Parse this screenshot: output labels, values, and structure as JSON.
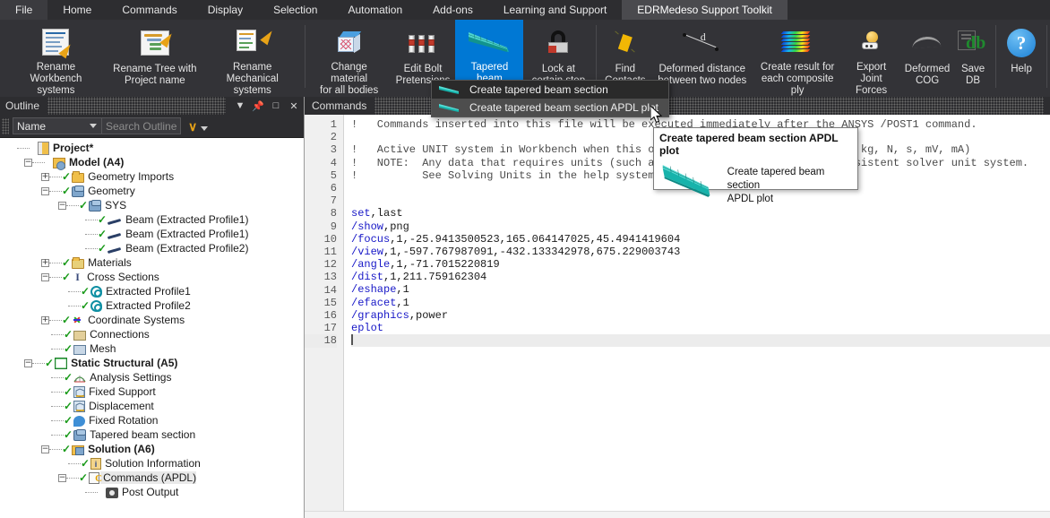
{
  "menu": {
    "items": [
      {
        "label": "File",
        "state": "file"
      },
      {
        "label": "Home",
        "state": "normal"
      },
      {
        "label": "Commands",
        "state": "normal"
      },
      {
        "label": "Display",
        "state": "normal"
      },
      {
        "label": "Selection",
        "state": "normal"
      },
      {
        "label": "Automation",
        "state": "normal"
      },
      {
        "label": "Add-ons",
        "state": "normal"
      },
      {
        "label": "Learning and Support",
        "state": "normal"
      },
      {
        "label": "EDRMedeso Support Toolkit",
        "state": "active"
      }
    ]
  },
  "ribbon": {
    "buttons": [
      {
        "label": "Rename Workbench\nsystems",
        "icon": "rename-workbench-icon"
      },
      {
        "label": "Rename Tree with\nProject name",
        "icon": "rename-tree-icon"
      },
      {
        "label": "Rename Mechanical\nsystems",
        "icon": "rename-mechanical-icon"
      },
      {
        "label": "Change material\nfor all bodies",
        "icon": "change-material-icon"
      },
      {
        "label": "Edit Bolt\nPretensions",
        "icon": "edit-bolt-pretensions-icon"
      },
      {
        "label": "Tapered beam\nsection",
        "icon": "tapered-beam-section-icon",
        "selected": true,
        "has_dropdown": true
      },
      {
        "label": "Lock at\ncertain step",
        "icon": "lock-at-certain-step-icon"
      },
      {
        "label": "Find\nContacts",
        "icon": "find-contacts-icon"
      },
      {
        "label": "Deformed distance\nbetween two nodes",
        "icon": "deformed-distance-icon"
      },
      {
        "label": "Create result for\neach composite ply",
        "icon": "composite-ply-icon"
      },
      {
        "label": "Export Joint\nForces",
        "icon": "export-joint-forces-icon"
      },
      {
        "label": "Deformed\nCOG",
        "icon": "deformed-cog-icon"
      },
      {
        "label": "Save\nDB",
        "icon": "save-db-icon",
        "icon_text": "db"
      },
      {
        "label": "Help",
        "icon": "help-icon",
        "icon_text": "?"
      }
    ]
  },
  "dropdown": {
    "items": [
      {
        "label": "Create tapered beam section",
        "hover": false
      },
      {
        "label": "Create tapered beam section APDL plot",
        "hover": true
      }
    ]
  },
  "tooltip": {
    "title": "Create tapered beam section APDL plot",
    "body": "Create tapered beam section\nAPDL plot"
  },
  "outline": {
    "title": "Outline",
    "title_buttons": [
      "chevron-down-icon",
      "pin-icon",
      "maximize-icon",
      "close-icon"
    ],
    "filter_selected": "Name",
    "search_placeholder": "Search Outline",
    "tree": [
      {
        "label": "Project*",
        "depth": 0,
        "expander": "",
        "check": "",
        "icon": "project-icon",
        "bold": true
      },
      {
        "label": "Model (A4)",
        "depth": 1,
        "expander": "-",
        "check": "",
        "icon": "model-icon",
        "bold": true
      },
      {
        "label": "Geometry Imports",
        "depth": 2,
        "expander": "+",
        "check": "ok",
        "icon": "folder-icon"
      },
      {
        "label": "Geometry",
        "depth": 2,
        "expander": "-",
        "check": "ok",
        "icon": "geometry-icon"
      },
      {
        "label": "SYS",
        "depth": 3,
        "expander": "-",
        "check": "okx",
        "icon": "geometry-icon"
      },
      {
        "label": "Beam (Extracted Profile1)",
        "depth": 4,
        "expander": "",
        "check": "okx",
        "icon": "beam-icon"
      },
      {
        "label": "Beam (Extracted Profile1)",
        "depth": 4,
        "expander": "",
        "check": "okx",
        "icon": "beam-icon"
      },
      {
        "label": "Beam (Extracted Profile2)",
        "depth": 4,
        "expander": "",
        "check": "okx",
        "icon": "beam-icon"
      },
      {
        "label": "Materials",
        "depth": 2,
        "expander": "+",
        "check": "ok",
        "icon": "materials-icon"
      },
      {
        "label": "Cross Sections",
        "depth": 2,
        "expander": "-",
        "check": "ok",
        "icon": "cross-section-icon"
      },
      {
        "label": "Extracted Profile1",
        "depth": 3,
        "expander": "",
        "check": "ok",
        "icon": "profile-icon"
      },
      {
        "label": "Extracted Profile2",
        "depth": 3,
        "expander": "",
        "check": "ok",
        "icon": "profile-icon"
      },
      {
        "label": "Coordinate Systems",
        "depth": 2,
        "expander": "+",
        "check": "okx",
        "icon": "coordinate-systems-icon"
      },
      {
        "label": "Connections",
        "depth": 2,
        "expander": "",
        "check": "ok",
        "icon": "connections-icon"
      },
      {
        "label": "Mesh",
        "depth": 2,
        "expander": "",
        "check": "ok",
        "icon": "mesh-icon"
      },
      {
        "label": "Static Structural (A5)",
        "depth": 1,
        "expander": "-",
        "check": "ok",
        "icon": "static-structural-icon",
        "bold": true
      },
      {
        "label": "Analysis Settings",
        "depth": 2,
        "expander": "",
        "check": "ok",
        "icon": "analysis-settings-icon"
      },
      {
        "label": "Fixed Support",
        "depth": 2,
        "expander": "",
        "check": "ok",
        "icon": "support-icon"
      },
      {
        "label": "Displacement",
        "depth": 2,
        "expander": "",
        "check": "ok",
        "icon": "support-icon"
      },
      {
        "label": "Fixed Rotation",
        "depth": 2,
        "expander": "",
        "check": "ok",
        "icon": "rotation-icon"
      },
      {
        "label": "Tapered beam section",
        "depth": 2,
        "expander": "",
        "check": "okx",
        "icon": "geometry-icon"
      },
      {
        "label": "Solution (A6)",
        "depth": 2,
        "expander": "-",
        "check": "ok",
        "icon": "solution-icon",
        "bold": true
      },
      {
        "label": "Solution Information",
        "depth": 3,
        "expander": "",
        "check": "ok",
        "icon": "solution-information-icon"
      },
      {
        "label": "Commands (APDL)",
        "depth": 3,
        "expander": "-",
        "check": "ok",
        "icon": "commands-apdl-icon",
        "selected": true
      },
      {
        "label": "Post Output",
        "depth": 4,
        "expander": "",
        "check": "",
        "icon": "post-output-icon"
      }
    ]
  },
  "editor": {
    "title": "Commands",
    "lines": [
      {
        "n": "1",
        "comment": "!   Commands inserted into this file will be executed immediately after the ANSYS /POST1 command.",
        "code": ""
      },
      {
        "n": "2",
        "comment": "",
        "code": ""
      },
      {
        "n": "3",
        "comment": "!   Active UNIT system in Workbench when this object was created:  Metric (mm, kg, N, s, mV, mA)",
        "code": ""
      },
      {
        "n": "4",
        "comment": "!   NOTE:  Any data that requires units (such as mass) is assumed to be in consistent solver unit system.",
        "code": ""
      },
      {
        "n": "5",
        "comment": "!          See Solving Units in the help system for more information.",
        "code": ""
      },
      {
        "n": "6",
        "comment": "",
        "code": ""
      },
      {
        "n": "7",
        "comment": "",
        "code": ""
      },
      {
        "n": "8",
        "comment": "",
        "code": "set,last",
        "kw": "set"
      },
      {
        "n": "9",
        "comment": "",
        "code": "/show,png",
        "kw": "/show"
      },
      {
        "n": "10",
        "comment": "",
        "code": "/focus,1,-25.9413500523,165.064147025,45.4941419604",
        "kw": "/focus"
      },
      {
        "n": "11",
        "comment": "",
        "code": "/view,1,-597.767987091,-432.133342978,675.229003743",
        "kw": "/view"
      },
      {
        "n": "12",
        "comment": "",
        "code": "/angle,1,-71.7015220819",
        "kw": "/angle"
      },
      {
        "n": "13",
        "comment": "",
        "code": "/dist,1,211.759162304",
        "kw": "/dist"
      },
      {
        "n": "14",
        "comment": "",
        "code": "/eshape,1",
        "kw": "/eshape"
      },
      {
        "n": "15",
        "comment": "",
        "code": "/efacet,1",
        "kw": "/efacet"
      },
      {
        "n": "16",
        "comment": "",
        "code": "/graphics,power",
        "kw": "/graphics"
      },
      {
        "n": "17",
        "comment": "",
        "code": "eplot",
        "kw": "eplot"
      },
      {
        "n": "18",
        "comment": "",
        "code": "",
        "current": true
      }
    ]
  },
  "colors": {
    "accent_blue": "#0078d4",
    "teal": "#1bb8b0",
    "menu_bg": "#2d2d30",
    "ribbon_bg": "#333337",
    "keyword_blue": "#1717c7",
    "check_green": "#1a9a1a"
  }
}
